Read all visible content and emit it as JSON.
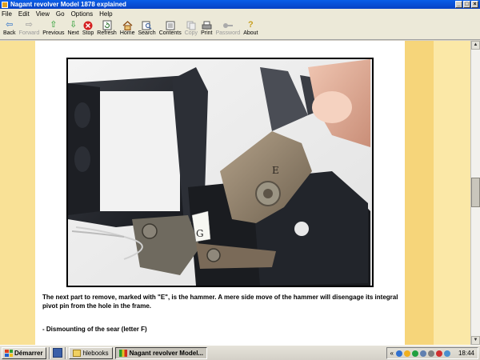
{
  "window": {
    "title": "Nagant revolver Model 1878 explained",
    "controls": [
      "_",
      "□",
      "×"
    ]
  },
  "menu": [
    "File",
    "Edit",
    "View",
    "Go",
    "Options",
    "Help"
  ],
  "toolbar": {
    "buttons": [
      {
        "label": "Back",
        "icon": "back-arrow-icon",
        "color": "#2a6fc9",
        "enabled": true
      },
      {
        "label": "Forward",
        "icon": "forward-arrow-icon",
        "color": "#9a9a9a",
        "enabled": false
      },
      {
        "label": "Previous",
        "icon": "up-arrow-icon",
        "color": "#1f9a2a",
        "enabled": true
      },
      {
        "label": "Next",
        "icon": "down-arrow-icon",
        "color": "#1f9a2a",
        "enabled": true
      },
      {
        "label": "Stop",
        "icon": "stop-icon",
        "color": "#d42020",
        "enabled": true
      },
      {
        "label": "Refresh",
        "icon": "refresh-icon",
        "color": "#3a7a3a",
        "enabled": true
      },
      {
        "label": "Home",
        "icon": "home-icon",
        "color": "#b06a20",
        "enabled": true
      },
      {
        "label": "Search",
        "icon": "search-icon",
        "color": "#4a6aa0",
        "enabled": true
      },
      {
        "label": "Contents",
        "icon": "contents-icon",
        "color": "#5a5a5a",
        "enabled": true
      },
      {
        "label": "Copy",
        "icon": "copy-icon",
        "color": "#9a9a9a",
        "enabled": false
      },
      {
        "label": "Print",
        "icon": "print-icon",
        "color": "#5a5a5a",
        "enabled": true
      },
      {
        "label": "Password",
        "icon": "key-icon",
        "color": "#9a9a9a",
        "enabled": false
      },
      {
        "label": "About",
        "icon": "about-icon",
        "color": "#c8a020",
        "enabled": true
      }
    ]
  },
  "page": {
    "paragraph": "The next part to remove, marked with \"E\", is the hammer. A mere side move of the hammer will disengage its integral pivot pin from the hole in the frame.",
    "subheading": "- Dismounting of the sear (letter F)",
    "photo_labels": {
      "hammer_mark": "E",
      "sear_mark": "G"
    }
  },
  "taskbar": {
    "start_label": "Démarrer",
    "tasks": [
      {
        "label": "hlebooks",
        "active": false
      },
      {
        "label": "Nagant revolver Model...",
        "active": true
      }
    ],
    "tray_expand": "«",
    "clock": "18:44"
  },
  "colors": {
    "accent": "#0a5ee8",
    "page_background": "#ffffff",
    "side_band": "#fbdf8d"
  }
}
